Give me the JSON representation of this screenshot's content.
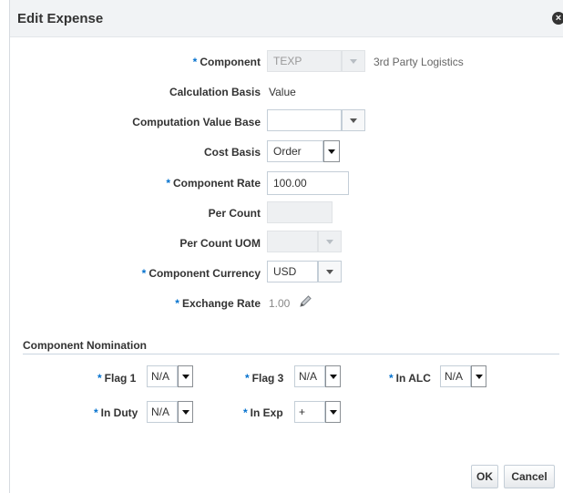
{
  "dialog": {
    "title": "Edit Expense"
  },
  "form": {
    "component_label": "Component",
    "component_value": "TEXP",
    "component_desc": "3rd Party Logistics",
    "calc_basis_label": "Calculation Basis",
    "calc_basis_value": "Value",
    "comp_value_base_label": "Computation Value Base",
    "comp_value_base_value": "",
    "cost_basis_label": "Cost Basis",
    "cost_basis_value": "Order",
    "comp_rate_label": "Component Rate",
    "comp_rate_value": "100.00",
    "per_count_label": "Per Count",
    "per_count_value": "",
    "per_count_uom_label": "Per Count UOM",
    "per_count_uom_value": "",
    "comp_currency_label": "Component Currency",
    "comp_currency_value": "USD",
    "exchange_rate_label": "Exchange Rate",
    "exchange_rate_value": "1.00",
    "required_marker": "*"
  },
  "nomination": {
    "title": "Component Nomination",
    "flag1_label": "Flag 1",
    "flag1_value": "N/A",
    "flag3_label": "Flag 3",
    "flag3_value": "N/A",
    "in_alc_label": "In ALC",
    "in_alc_value": "N/A",
    "in_duty_label": "In Duty",
    "in_duty_value": "N/A",
    "in_exp_label": "In Exp",
    "in_exp_value": "+"
  },
  "buttons": {
    "ok": "OK",
    "cancel": "Cancel"
  },
  "icons": {
    "close": "close-icon",
    "edit": "pencil-icon",
    "dropdown": "chevron-down-icon"
  }
}
